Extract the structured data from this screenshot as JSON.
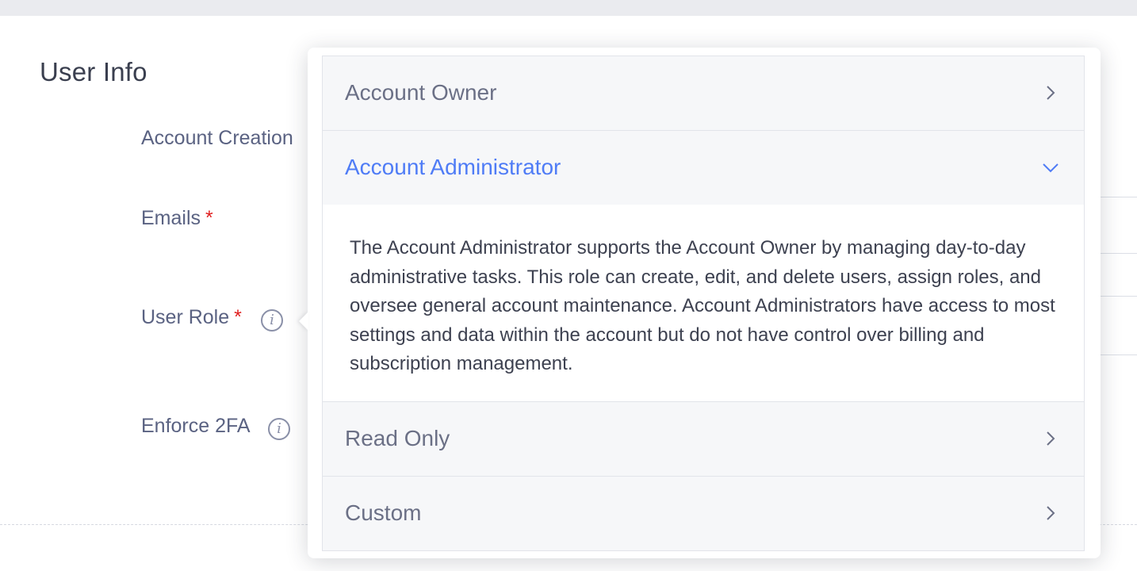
{
  "form": {
    "section_title": "User Info",
    "labels": {
      "account_creation": "Account Creation",
      "emails": "Emails",
      "user_role": "User Role",
      "enforce_2fa": "Enforce 2FA"
    },
    "required_marker": "*",
    "info_icon_glyph": "i"
  },
  "role_popover": {
    "items": [
      {
        "title": "Account Owner",
        "expanded": false,
        "icon": "chevron-right-icon"
      },
      {
        "title": "Account Administrator",
        "expanded": true,
        "icon": "chevron-down-icon",
        "description": "The Account Administrator supports the Account Owner by managing day-to-day administrative tasks. This role can create, edit, and delete users, assign roles, and oversee general account maintenance. Account Administrators have access to most settings and data within the account but do not have control over billing and subscription management."
      },
      {
        "title": "Read Only",
        "expanded": false,
        "icon": "chevron-right-icon"
      },
      {
        "title": "Custom",
        "expanded": false,
        "icon": "chevron-right-icon"
      }
    ]
  },
  "colors": {
    "accent": "#4f7cf6",
    "required": "#e02020",
    "label": "#5a6282",
    "header_bg": "#f6f7f9"
  }
}
